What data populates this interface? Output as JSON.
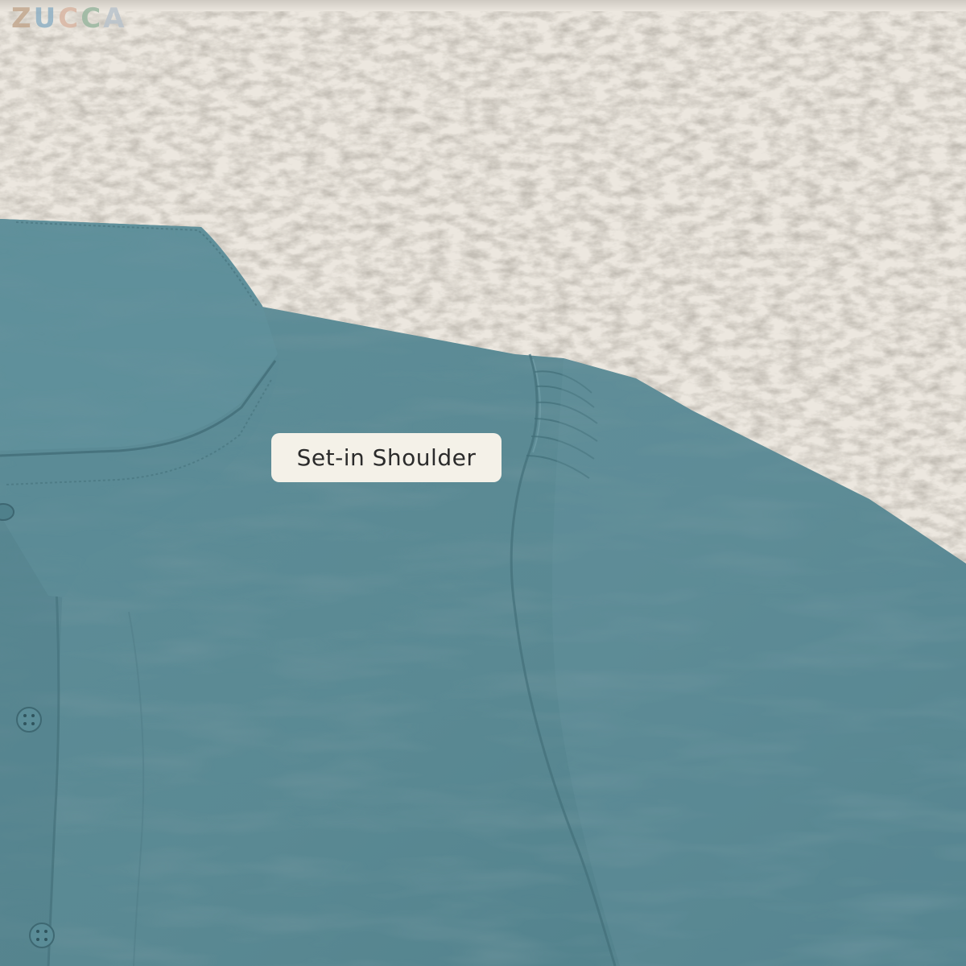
{
  "logo": {
    "letters": [
      "Z",
      "U",
      "C",
      "C",
      "A"
    ],
    "colors": [
      "#c3a88f",
      "#8fb0c4",
      "#d9b6a3",
      "#9ab7a0",
      "#b9c3cc"
    ]
  },
  "annotation": {
    "label": "Set-in Shoulder"
  },
  "palette": {
    "rug": "#eae5dc",
    "shirt": "#5b8a95",
    "shirt_dark": "#4a7782",
    "shirt_light": "#6c9aa5",
    "label_bg": "#f4f1e8"
  },
  "image": {
    "subject": "photo",
    "content": "teal button-up shirt with collar and puffed set-in shoulder lying on a white shaggy rug"
  }
}
